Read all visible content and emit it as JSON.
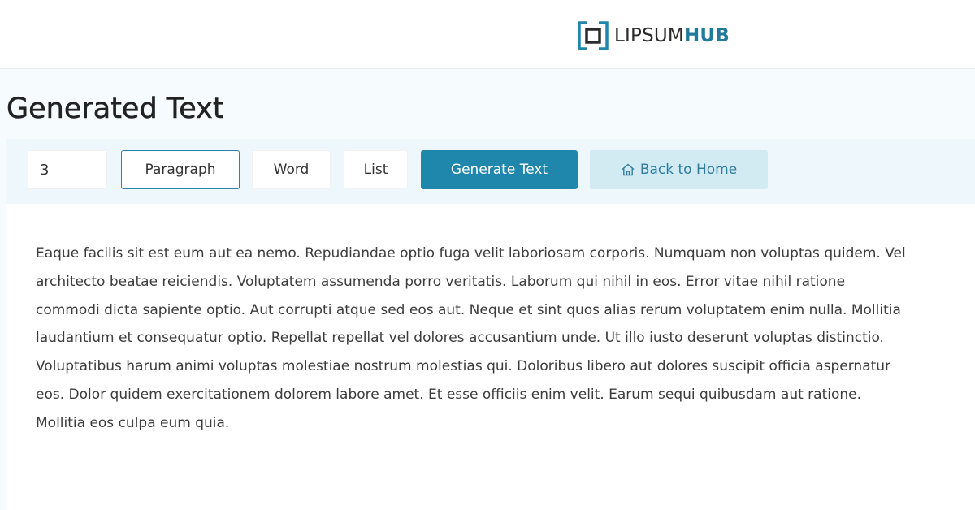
{
  "header": {
    "logo": {
      "text_main": "LIPSUM",
      "text_accent": "HUB",
      "icon": "logo-bracket-square-icon",
      "accent_color": "#1f7a9b"
    }
  },
  "main": {
    "title": "Generated Text",
    "controls": {
      "count_value": "3",
      "types": [
        {
          "label": "Paragraph",
          "active": true
        },
        {
          "label": "Word",
          "active": false
        },
        {
          "label": "List",
          "active": false
        }
      ],
      "generate_label": "Generate Text",
      "home_label": "Back to Home",
      "home_icon": "house-icon",
      "primary_color": "#1f86ac",
      "secondary_color": "#d2eaf2"
    },
    "output": {
      "text": "Eaque facilis sit est eum aut ea nemo. Repudiandae optio fuga velit laboriosam corporis. Numquam non voluptas quidem. Vel architecto beatae reiciendis. Voluptatem assumenda porro veritatis. Laborum qui nihil in eos. Error vitae nihil ratione commodi dicta sapiente optio. Aut corrupti atque sed eos aut. Neque et sint quos alias rerum voluptatem enim nulla. Mollitia laudantium et consequatur optio. Repellat repellat vel dolores accusantium unde. Ut illo iusto deserunt voluptas distinctio. Voluptatibus harum animi voluptas molestiae nostrum molestias qui. Doloribus libero aut dolores suscipit officia aspernatur eos. Dolor quidem exercitationem dolorem labore amet. Et esse officiis enim velit. Earum sequi quibusdam aut ratione. Mollitia eos culpa eum quia."
    }
  }
}
